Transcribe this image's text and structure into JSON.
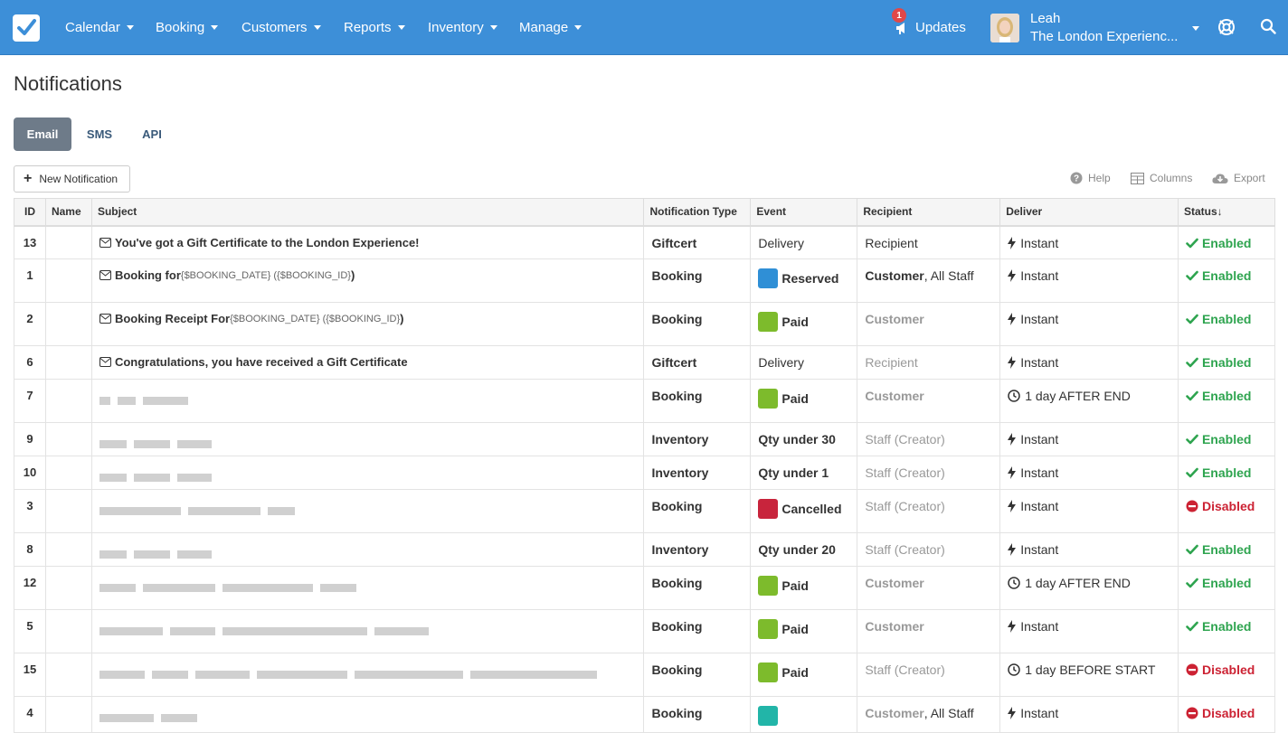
{
  "nav": {
    "items": [
      {
        "label": "Calendar"
      },
      {
        "label": "Booking"
      },
      {
        "label": "Customers"
      },
      {
        "label": "Reports"
      },
      {
        "label": "Inventory"
      },
      {
        "label": "Manage"
      }
    ],
    "updates_label": "Updates",
    "updates_count": "1",
    "user_name": "Leah",
    "user_org": "The London Experienc..."
  },
  "page": {
    "title": "Notifications",
    "tabs": [
      {
        "label": "Email",
        "active": true
      },
      {
        "label": "SMS",
        "active": false
      },
      {
        "label": "API",
        "active": false
      }
    ],
    "new_button": "New Notification",
    "tools": {
      "help": "Help",
      "columns": "Columns",
      "export": "Export"
    }
  },
  "table": {
    "headers": {
      "id": "ID",
      "name": "Name",
      "subject": "Subject",
      "type": "Notification Type",
      "event": "Event",
      "recipient": "Recipient",
      "deliver": "Deliver",
      "status": "Status↓"
    },
    "rows": [
      {
        "id": "13",
        "subject": "You've got a Gift Certificate to the London Experience!",
        "subject_tmpl": "",
        "subject_tail": "",
        "type": "Giftcert",
        "event": "Delivery",
        "event_color": "",
        "recipient_main": "Recipient",
        "recipient_extra": "",
        "deliver": "Instant",
        "deliver_icon": "bolt",
        "status": "Enabled"
      },
      {
        "id": "1",
        "subject": "Booking for ",
        "subject_tmpl": "{$BOOKING_DATE} ({$BOOKING_ID}",
        "subject_tail": ")",
        "type": "Booking",
        "event": "Reserved",
        "event_color": "#2f8fd6",
        "recipient_main": "Customer",
        "recipient_extra": ", All Staff",
        "deliver": "Instant",
        "deliver_icon": "bolt",
        "status": "Enabled"
      },
      {
        "id": "2",
        "subject": "Booking Receipt For ",
        "subject_tmpl": "{$BOOKING_DATE} ({$BOOKING_ID}",
        "subject_tail": ")",
        "type": "Booking",
        "event": "Paid",
        "event_color": "#7dbb2c",
        "recipient_main": "Customer",
        "recipient_extra": "",
        "deliver": "Instant",
        "deliver_icon": "bolt",
        "status": "Enabled"
      },
      {
        "id": "6",
        "subject": "Congratulations, you have received a Gift Certificate",
        "subject_tmpl": "",
        "subject_tail": "",
        "type": "Giftcert",
        "event": "Delivery",
        "event_color": "",
        "recipient_main": "Recipient",
        "recipient_extra": "",
        "deliver": "Instant",
        "deliver_icon": "bolt",
        "status": "Enabled"
      },
      {
        "id": "7",
        "subject": "",
        "subject_tmpl": "",
        "subject_tail": "",
        "type": "Booking",
        "event": "Paid",
        "event_color": "#7dbb2c",
        "recipient_main": "Customer",
        "recipient_extra": "",
        "deliver": "1 day AFTER END",
        "deliver_icon": "clock",
        "status": "Enabled"
      },
      {
        "id": "9",
        "subject": "",
        "subject_tmpl": "",
        "subject_tail": "",
        "type": "Inventory",
        "event": "Qty under 30",
        "event_color": "",
        "recipient_main": "Staff (Creator)",
        "recipient_extra": "",
        "deliver": "Instant",
        "deliver_icon": "bolt",
        "status": "Enabled"
      },
      {
        "id": "10",
        "subject": "",
        "subject_tmpl": "",
        "subject_tail": "",
        "type": "Inventory",
        "event": "Qty under 1",
        "event_color": "",
        "recipient_main": "Staff (Creator)",
        "recipient_extra": "",
        "deliver": "Instant",
        "deliver_icon": "bolt",
        "status": "Enabled"
      },
      {
        "id": "3",
        "subject": "",
        "subject_tmpl": "",
        "subject_tail": "",
        "type": "Booking",
        "event": "Cancelled",
        "event_color": "#c8243c",
        "recipient_main": "Staff (Creator)",
        "recipient_extra": "",
        "deliver": "Instant",
        "deliver_icon": "bolt",
        "status": "Disabled"
      },
      {
        "id": "8",
        "subject": "",
        "subject_tmpl": "",
        "subject_tail": "",
        "type": "Inventory",
        "event": "Qty under 20",
        "event_color": "",
        "recipient_main": "Staff (Creator)",
        "recipient_extra": "",
        "deliver": "Instant",
        "deliver_icon": "bolt",
        "status": "Enabled"
      },
      {
        "id": "12",
        "subject": "",
        "subject_tmpl": "",
        "subject_tail": "",
        "type": "Booking",
        "event": "Paid",
        "event_color": "#7dbb2c",
        "recipient_main": "Customer",
        "recipient_extra": "",
        "deliver": "1 day AFTER END",
        "deliver_icon": "clock",
        "status": "Enabled"
      },
      {
        "id": "5",
        "subject": "",
        "subject_tmpl": "",
        "subject_tail": "",
        "type": "Booking",
        "event": "Paid",
        "event_color": "#7dbb2c",
        "recipient_main": "Customer",
        "recipient_extra": "",
        "deliver": "Instant",
        "deliver_icon": "bolt",
        "status": "Enabled"
      },
      {
        "id": "15",
        "subject": "",
        "subject_tmpl": "",
        "subject_tail": "",
        "type": "Booking",
        "event": "Paid",
        "event_color": "#7dbb2c",
        "recipient_main": "Staff (Creator)",
        "recipient_extra": "",
        "deliver": "1 day BEFORE START",
        "deliver_icon": "clock",
        "status": "Disabled"
      },
      {
        "id": "4",
        "subject": "",
        "subject_tmpl": "",
        "subject_tail": "",
        "type": "Booking",
        "event": "",
        "event_color": "#22b5a8",
        "recipient_main": "Customer",
        "recipient_extra": ", All Staff",
        "deliver": "Instant",
        "deliver_icon": "bolt",
        "status": "Disabled"
      }
    ]
  },
  "colors": {
    "topbar": "#3d8fd8",
    "enabled": "#2ea44f",
    "disabled": "#cc2233",
    "tab_active": "#6e7b89"
  },
  "icons": [
    "logo-check-icon",
    "caret-down-icon",
    "megaphone-icon",
    "globe-icon",
    "search-icon",
    "question-icon",
    "columns-icon",
    "cloud-download-icon",
    "envelope-icon",
    "bolt-icon",
    "clock-icon",
    "check-icon",
    "no-entry-icon",
    "plus-icon"
  ]
}
